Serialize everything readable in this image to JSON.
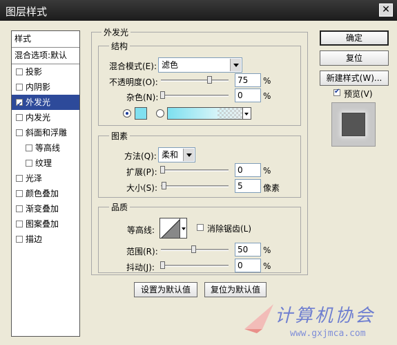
{
  "window": {
    "title": "图层样式",
    "close_icon": "close-icon"
  },
  "left_panel": {
    "header": "样式",
    "blend_options": "混合选项:默认",
    "items": [
      {
        "label": "投影",
        "checked": false,
        "selected": false,
        "sub": false
      },
      {
        "label": "内阴影",
        "checked": false,
        "selected": false,
        "sub": false
      },
      {
        "label": "外发光",
        "checked": true,
        "selected": true,
        "sub": false
      },
      {
        "label": "内发光",
        "checked": false,
        "selected": false,
        "sub": false
      },
      {
        "label": "斜面和浮雕",
        "checked": false,
        "selected": false,
        "sub": false
      },
      {
        "label": "等高线",
        "checked": false,
        "selected": false,
        "sub": true
      },
      {
        "label": "纹理",
        "checked": false,
        "selected": false,
        "sub": true
      },
      {
        "label": "光泽",
        "checked": false,
        "selected": false,
        "sub": false
      },
      {
        "label": "颜色叠加",
        "checked": false,
        "selected": false,
        "sub": false
      },
      {
        "label": "渐变叠加",
        "checked": false,
        "selected": false,
        "sub": false
      },
      {
        "label": "图案叠加",
        "checked": false,
        "selected": false,
        "sub": false
      },
      {
        "label": "描边",
        "checked": false,
        "selected": false,
        "sub": false
      }
    ]
  },
  "outer_glow": {
    "title": "外发光",
    "structure": {
      "title": "结构",
      "blend_mode_label": "混合模式(E):",
      "blend_mode_value": "滤色",
      "opacity_label": "不透明度(O):",
      "opacity_value": "75",
      "opacity_level": 0.75,
      "noise_label": "杂色(N):",
      "noise_value": "0",
      "noise_level": 0,
      "percent": "%",
      "color": "#80e0f0"
    },
    "elements": {
      "title": "图素",
      "method_label": "方法(Q):",
      "method_value": "柔和",
      "spread_label": "扩展(P):",
      "spread_value": "0",
      "spread_level": 0,
      "size_label": "大小(S):",
      "size_value": "5",
      "size_level": 0.02,
      "percent": "%",
      "pixels": "像素"
    },
    "quality": {
      "title": "品质",
      "contour_label": "等高线:",
      "antialias_label": "消除锯齿(L)",
      "range_label": "范围(R):",
      "range_value": "50",
      "range_level": 0.5,
      "jitter_label": "抖动(J):",
      "jitter_value": "0",
      "jitter_level": 0,
      "percent": "%"
    },
    "set_default": "设置为默认值",
    "reset_default": "复位为默认值"
  },
  "right_panel": {
    "ok": "确定",
    "reset": "复位",
    "new_style": "新建样式(W)...",
    "preview_label": "预览(V)",
    "preview_checked": true
  },
  "watermark": {
    "title": "计算机协会",
    "url": "www.gxjmca.com"
  }
}
